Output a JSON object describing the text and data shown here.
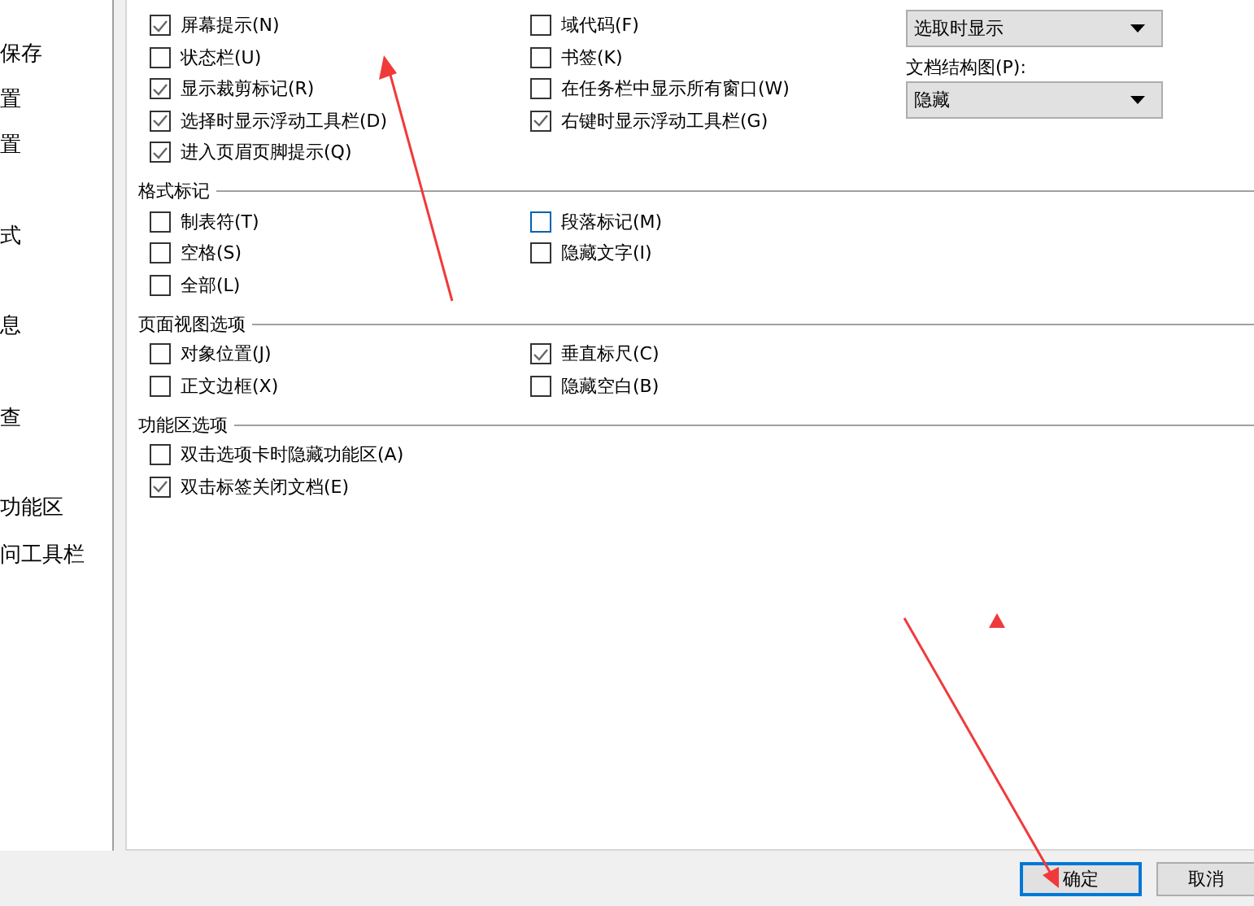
{
  "sidebar": {
    "items": [
      {
        "label": "保存"
      },
      {
        "label": "置"
      },
      {
        "label": "置"
      },
      {
        "label": "式"
      },
      {
        "label": "息"
      },
      {
        "label": "查"
      },
      {
        "label": "功能区"
      },
      {
        "label": "问工具栏"
      }
    ]
  },
  "display_options": {
    "columns": [
      [
        {
          "label": "屏幕提示(N)",
          "checked": true
        },
        {
          "label": "状态栏(U)",
          "checked": false
        },
        {
          "label": "显示裁剪标记(R)",
          "checked": true
        },
        {
          "label": "选择时显示浮动工具栏(D)",
          "checked": true
        },
        {
          "label": "进入页眉页脚提示(Q)",
          "checked": true
        }
      ],
      [
        {
          "label": "域代码(F)",
          "checked": false
        },
        {
          "label": "书签(K)",
          "checked": false
        },
        {
          "label": "在任务栏中显示所有窗口(W)",
          "checked": false
        },
        {
          "label": "右键时显示浮动工具栏(G)",
          "checked": true
        }
      ]
    ],
    "selects": [
      {
        "value": "选取时显示"
      },
      {
        "label": "文档结构图(P):",
        "value": "隐藏"
      }
    ]
  },
  "sections": [
    {
      "title": "格式标记",
      "columns": [
        [
          {
            "label": "制表符(T)",
            "checked": false
          },
          {
            "label": "空格(S)",
            "checked": false
          },
          {
            "label": "全部(L)",
            "checked": false
          }
        ],
        [
          {
            "label": "段落标记(M)",
            "checked": false,
            "focused": true
          },
          {
            "label": "隐藏文字(I)",
            "checked": false,
            "focused": false
          }
        ]
      ]
    },
    {
      "title": "页面视图选项",
      "columns": [
        [
          {
            "label": "对象位置(J)",
            "checked": false
          },
          {
            "label": "正文边框(X)",
            "checked": false
          }
        ],
        [
          {
            "label": "垂直标尺(C)",
            "checked": true
          },
          {
            "label": "隐藏空白(B)",
            "checked": false
          }
        ]
      ]
    },
    {
      "title": "功能区选项",
      "columns": [
        [
          {
            "label": "双击选项卡时隐藏功能区(A)",
            "checked": false
          },
          {
            "label": "双击标签关闭文档(E)",
            "checked": true
          }
        ]
      ]
    }
  ],
  "buttons": [
    {
      "label": "确定",
      "default": true
    },
    {
      "label": "取消",
      "default": false
    }
  ]
}
